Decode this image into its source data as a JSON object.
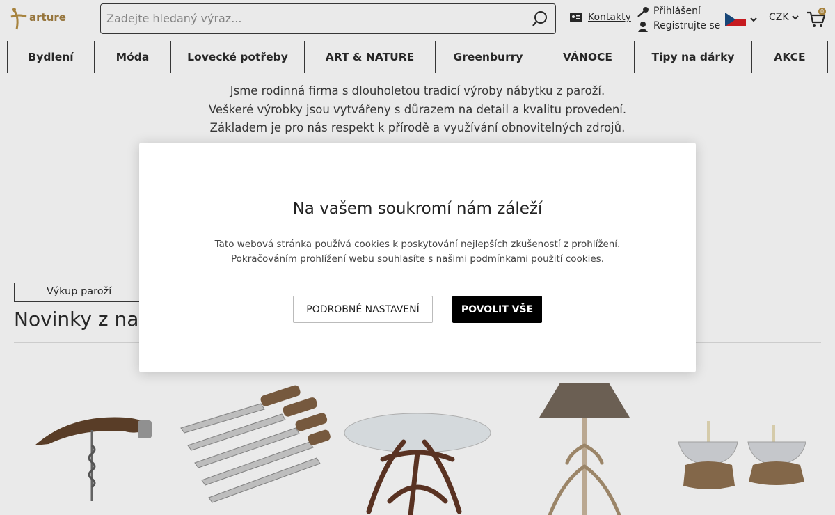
{
  "header": {
    "logo_text": "arture",
    "search_placeholder": "Zadejte hledaný výraz...",
    "contacts": "Kontakty",
    "login": "Přihlášení",
    "register": "Registrujte se",
    "currency": "CZK",
    "cart_count": "0"
  },
  "nav": [
    {
      "label": "Bydlení"
    },
    {
      "label": "Móda"
    },
    {
      "label": "Lovecké potřeby"
    },
    {
      "label": "ART & NATURE"
    },
    {
      "label": "Greenburry"
    },
    {
      "label": "VÁNOCE"
    },
    {
      "label": "Tipy na dárky"
    },
    {
      "label": "AKCE"
    }
  ],
  "intro": {
    "line1": "Jsme rodinná firma s dlouholetou tradicí výroby nábytku z paroží.",
    "line2": "Veškeré výrobky jsou vytvářeny s důrazem na detail a kvalitu provedení.",
    "line3": "Základem je pro nás respekt k přírodě a využívání obnovitelných zdrojů."
  },
  "main": {
    "vykup": "Výkup paroží",
    "novinky": "Novinky z naší"
  },
  "modal": {
    "title": "Na vašem soukromí nám záleží",
    "text": "Tato webová stránka používá cookies k poskytování nejlepších zkušeností z prohlížení. Pokračováním prohlížení webu souhlasíte s našimi podmínkami použití cookies.",
    "settings_button": "PODROBNÉ NASTAVENÍ",
    "accept_button": "POVOLIT VŠE"
  },
  "colors": {
    "brand": "#b38a3c",
    "accept_bg": "#000000"
  }
}
